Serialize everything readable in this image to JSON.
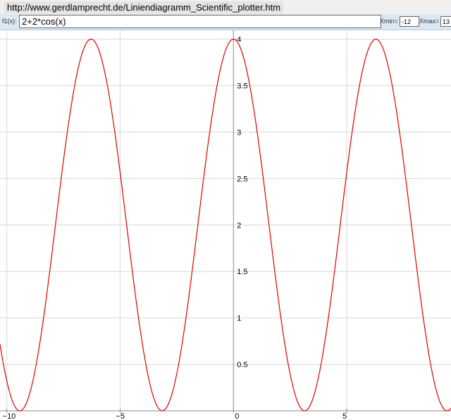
{
  "browser": {
    "url": "http://www.gerdlamprecht.de/Liniendiagramm_Scientific_plotter.htm"
  },
  "toolbar": {
    "f1_label": "f1(x):",
    "f1_value": "2+2*cos(x)",
    "xmin_label": "Xmin=",
    "xmin_value": "-12",
    "xmax_label": "Xmax=",
    "xmax_value": "13"
  },
  "chart_data": {
    "type": "line",
    "function": "2+2*cos(x)",
    "xlim": [
      -10.3,
      9.6
    ],
    "ylim": [
      0,
      4.05
    ],
    "x_ticks": [
      {
        "value": -10,
        "label": "−10"
      },
      {
        "value": -5,
        "label": "−5"
      },
      {
        "value": 0,
        "label": "0"
      },
      {
        "value": 5,
        "label": "5"
      }
    ],
    "y_ticks": [
      {
        "value": 0.5,
        "label": "0.5"
      },
      {
        "value": 1,
        "label": "1"
      },
      {
        "value": 1.5,
        "label": "1.5"
      },
      {
        "value": 2,
        "label": "2"
      },
      {
        "value": 2.5,
        "label": "2.5"
      },
      {
        "value": 3,
        "label": "3"
      },
      {
        "value": 3.5,
        "label": "3.5"
      },
      {
        "value": 4,
        "label": "4"
      }
    ],
    "grid": true,
    "line_color": "#e00000",
    "grid_color": "#d8d8d8",
    "axis_color": "#888888"
  }
}
